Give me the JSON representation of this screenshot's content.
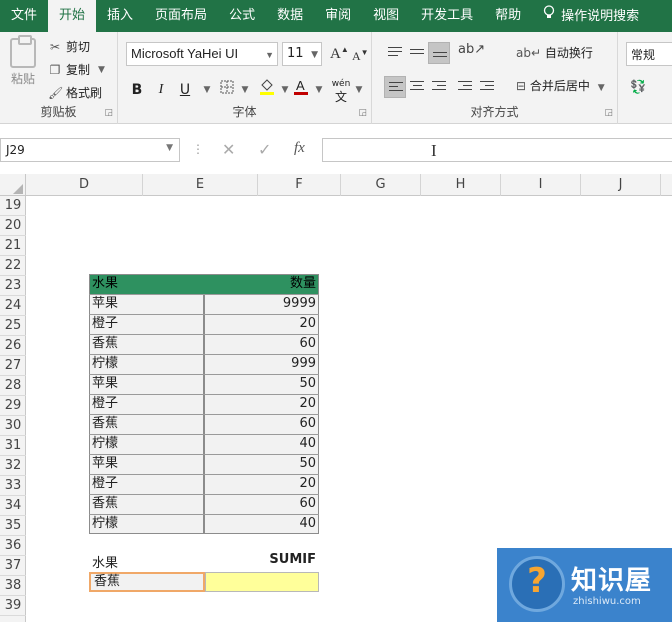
{
  "ribbon": {
    "tabs": [
      {
        "label": "文件",
        "active": false
      },
      {
        "label": "开始",
        "active": true
      },
      {
        "label": "插入",
        "active": false
      },
      {
        "label": "页面布局",
        "active": false
      },
      {
        "label": "公式",
        "active": false
      },
      {
        "label": "数据",
        "active": false
      },
      {
        "label": "审阅",
        "active": false
      },
      {
        "label": "视图",
        "active": false
      },
      {
        "label": "开发工具",
        "active": false
      },
      {
        "label": "帮助",
        "active": false
      }
    ],
    "tell_me": "操作说明搜索",
    "clipboard": {
      "paste": "粘贴",
      "cut": "剪切",
      "copy": "复制",
      "format_painter": "格式刷",
      "group_label": "剪贴板"
    },
    "font": {
      "name": "Microsoft YaHei UI",
      "size": "11",
      "bold": "B",
      "italic": "I",
      "underline": "U",
      "phonetic": "wén",
      "group_label": "字体"
    },
    "alignment": {
      "wrap_text": "自动换行",
      "merge_center": "合并后居中",
      "group_label": "对齐方式"
    },
    "number": {
      "format": "常规"
    }
  },
  "formula_bar": {
    "name_box": "J29",
    "fx": "fx",
    "formula": ""
  },
  "columns": [
    "D",
    "E",
    "F",
    "G",
    "H",
    "I",
    "J"
  ],
  "rows": [
    "19",
    "20",
    "21",
    "22",
    "23",
    "24",
    "25",
    "26",
    "27",
    "28",
    "29",
    "30",
    "31",
    "32",
    "33",
    "34",
    "35",
    "36",
    "37",
    "38",
    "39"
  ],
  "table": {
    "headers": [
      "水果",
      "数量"
    ],
    "rows": [
      [
        "苹果",
        "9999"
      ],
      [
        "橙子",
        "20"
      ],
      [
        "香蕉",
        "60"
      ],
      [
        "柠檬",
        "999"
      ],
      [
        "苹果",
        "50"
      ],
      [
        "橙子",
        "20"
      ],
      [
        "香蕉",
        "60"
      ],
      [
        "柠檬",
        "40"
      ],
      [
        "苹果",
        "50"
      ],
      [
        "橙子",
        "20"
      ],
      [
        "香蕉",
        "60"
      ],
      [
        "柠檬",
        "40"
      ]
    ]
  },
  "criteria": {
    "label": "水果",
    "sumif_label": "SUMIF",
    "value": "香蕉",
    "result": ""
  },
  "watermark": {
    "title": "知识屋",
    "subtitle": "zhishiwu.com",
    "icon_char": "?"
  },
  "colors": {
    "ribbon_green": "#217346",
    "table_header": "#2e9160",
    "criteria_border": "#f0a868",
    "result_fill": "#ffff9a",
    "watermark_blue": "#3b83cc"
  }
}
